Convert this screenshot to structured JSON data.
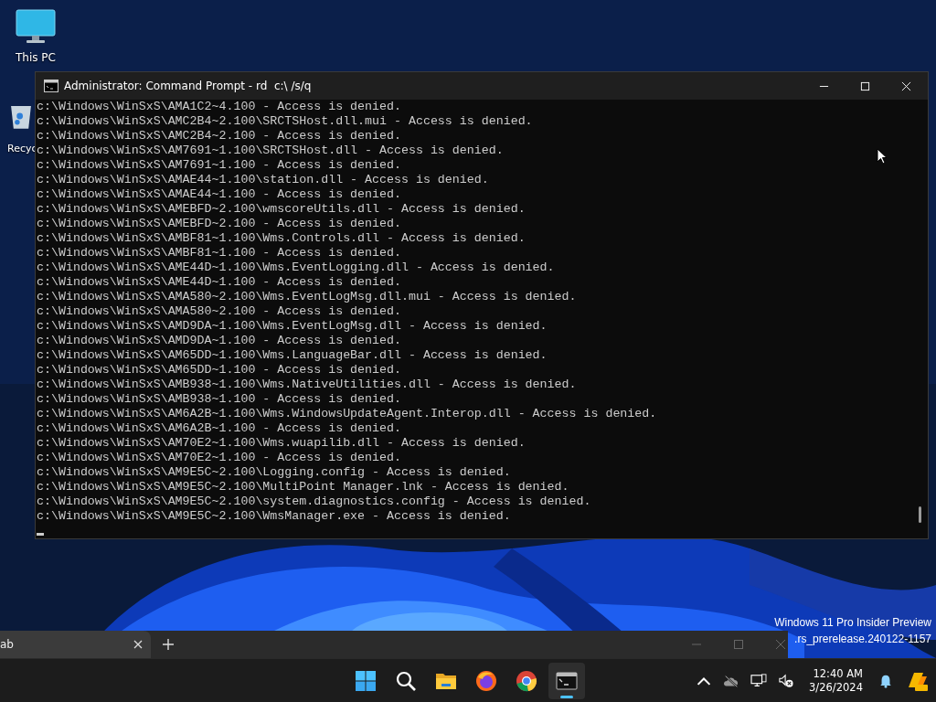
{
  "desktop": {
    "icons": [
      {
        "kind": "computer",
        "label": "This PC"
      },
      {
        "kind": "recycle",
        "label": "Recyc"
      }
    ],
    "watermark": [
      "Windows 11 Pro Insider Preview",
      ".rs_prerelease.240122-1157"
    ]
  },
  "console": {
    "title": "Administrator: Command Prompt - rd  c:\\ /s/q",
    "lines": [
      "c:\\Windows\\WinSxS\\AMA1C2~4.100 - Access is denied.",
      "c:\\Windows\\WinSxS\\AMC2B4~2.100\\SRCTSHost.dll.mui - Access is denied.",
      "c:\\Windows\\WinSxS\\AMC2B4~2.100 - Access is denied.",
      "c:\\Windows\\WinSxS\\AM7691~1.100\\SRCTSHost.dll - Access is denied.",
      "c:\\Windows\\WinSxS\\AM7691~1.100 - Access is denied.",
      "c:\\Windows\\WinSxS\\AMAE44~1.100\\station.dll - Access is denied.",
      "c:\\Windows\\WinSxS\\AMAE44~1.100 - Access is denied.",
      "c:\\Windows\\WinSxS\\AMEBFD~2.100\\wmscoreUtils.dll - Access is denied.",
      "c:\\Windows\\WinSxS\\AMEBFD~2.100 - Access is denied.",
      "c:\\Windows\\WinSxS\\AMBF81~1.100\\Wms.Controls.dll - Access is denied.",
      "c:\\Windows\\WinSxS\\AMBF81~1.100 - Access is denied.",
      "c:\\Windows\\WinSxS\\AME44D~1.100\\Wms.EventLogging.dll - Access is denied.",
      "c:\\Windows\\WinSxS\\AME44D~1.100 - Access is denied.",
      "c:\\Windows\\WinSxS\\AMA580~2.100\\Wms.EventLogMsg.dll.mui - Access is denied.",
      "c:\\Windows\\WinSxS\\AMA580~2.100 - Access is denied.",
      "c:\\Windows\\WinSxS\\AMD9DA~1.100\\Wms.EventLogMsg.dll - Access is denied.",
      "c:\\Windows\\WinSxS\\AMD9DA~1.100 - Access is denied.",
      "c:\\Windows\\WinSxS\\AM65DD~1.100\\Wms.LanguageBar.dll - Access is denied.",
      "c:\\Windows\\WinSxS\\AM65DD~1.100 - Access is denied.",
      "c:\\Windows\\WinSxS\\AMB938~1.100\\Wms.NativeUtilities.dll - Access is denied.",
      "c:\\Windows\\WinSxS\\AMB938~1.100 - Access is denied.",
      "c:\\Windows\\WinSxS\\AM6A2B~1.100\\Wms.WindowsUpdateAgent.Interop.dll - Access is denied.",
      "c:\\Windows\\WinSxS\\AM6A2B~1.100 - Access is denied.",
      "c:\\Windows\\WinSxS\\AM70E2~1.100\\Wms.wuapilib.dll - Access is denied.",
      "c:\\Windows\\WinSxS\\AM70E2~1.100 - Access is denied.",
      "c:\\Windows\\WinSxS\\AM9E5C~2.100\\Logging.config - Access is denied.",
      "c:\\Windows\\WinSxS\\AM9E5C~2.100\\MultiPoint Manager.lnk - Access is denied.",
      "c:\\Windows\\WinSxS\\AM9E5C~2.100\\system.diagnostics.config - Access is denied.",
      "c:\\Windows\\WinSxS\\AM9E5C~2.100\\WmsManager.exe - Access is denied."
    ]
  },
  "browser": {
    "tabs": [
      {
        "label": "ab",
        "selected": true
      }
    ]
  },
  "taskbar": {
    "apps": [
      {
        "kind": "start",
        "active": false
      },
      {
        "kind": "search",
        "active": false
      },
      {
        "kind": "folder",
        "active": false
      },
      {
        "kind": "firefox",
        "active": false
      },
      {
        "kind": "chrome",
        "active": false
      },
      {
        "kind": "terminal",
        "active": true
      }
    ],
    "clock": {
      "time": "12:40 AM",
      "date": "3/26/2024"
    }
  }
}
